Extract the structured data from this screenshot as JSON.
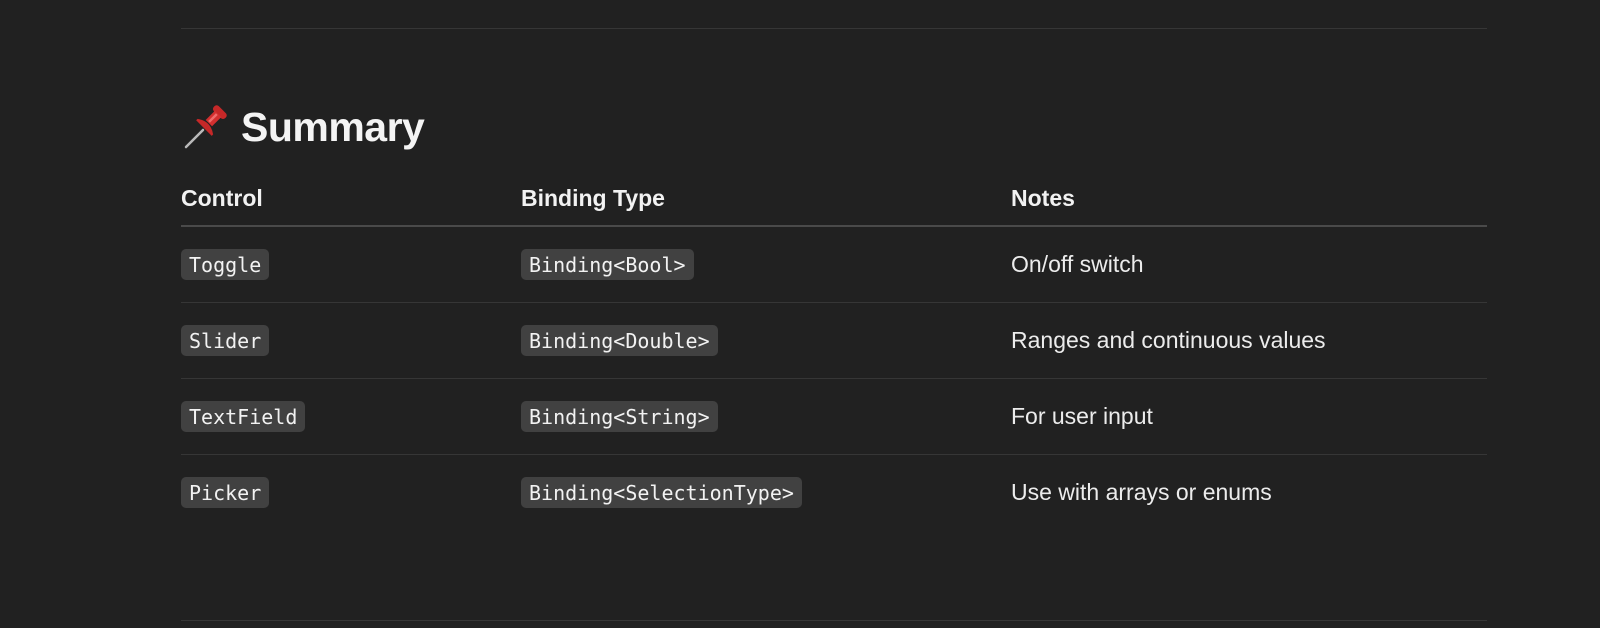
{
  "section": {
    "title": "Summary",
    "icon": "pushpin-icon"
  },
  "table": {
    "headers": [
      "Control",
      "Binding Type",
      "Notes"
    ],
    "rows": [
      {
        "control": "Toggle",
        "binding": "Binding<Bool>",
        "notes": "On/off switch"
      },
      {
        "control": "Slider",
        "binding": "Binding<Double>",
        "notes": "Ranges and continuous values"
      },
      {
        "control": "TextField",
        "binding": "Binding<String>",
        "notes": "For user input"
      },
      {
        "control": "Picker",
        "binding": "Binding<SelectionType>",
        "notes": "Use with arrays or enums"
      }
    ]
  },
  "colors": {
    "background": "#212121",
    "text": "#ececec",
    "code_background": "#414141",
    "divider": "#363636"
  }
}
